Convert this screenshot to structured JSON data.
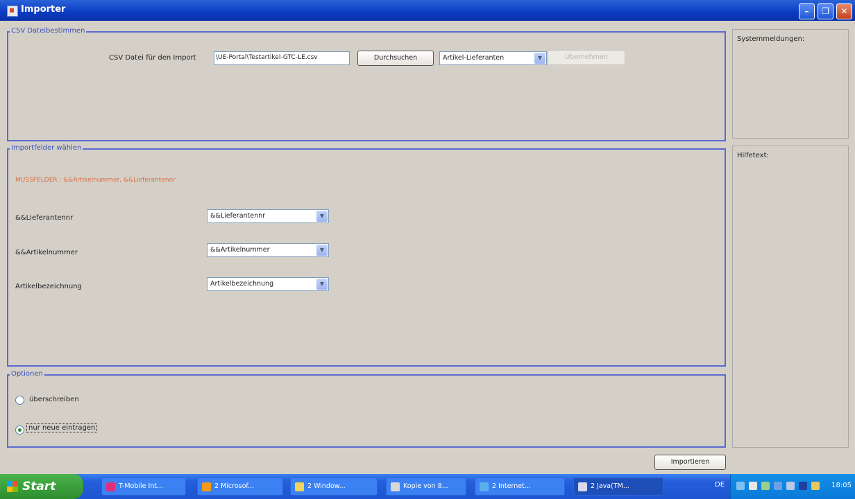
{
  "window": {
    "title": "Importer"
  },
  "csv": {
    "legend": "CSV Dateibestimmen",
    "label": "CSV Datei für den Import",
    "file_value": "\\UE-Portal\\Testartikel-GTC-LE.csv",
    "browse_label": "Durchsuchen",
    "type_selected": "Artikel-Lieferanten",
    "apply_label": "Übernehmen"
  },
  "side": {
    "messages_label": "Systemmeldungen:",
    "help_label": "Hilfetext:"
  },
  "fields": {
    "legend": "Importfelder wählen",
    "mandatory": "MUSSFELDER : &&Artikelnummer, &&Lieferantennr",
    "rows": [
      {
        "label": "&&Lieferantennr",
        "selected": "&&Lieferantennr"
      },
      {
        "label": "&&Artikelnummer",
        "selected": "&&Artikelnummer"
      },
      {
        "label": "Artikelbezeichnung",
        "selected": "Artikelbezeichnung"
      }
    ]
  },
  "options": {
    "legend": "Optionen",
    "overwrite_label": "überschreiben",
    "new_only_label": "nur neue eintragen",
    "selected": "nur neue eintragen"
  },
  "import_label": "Importieren",
  "taskbar": {
    "start_label": "Start",
    "items": [
      {
        "label": "T-Mobile Int...",
        "icon": "tmobile-icon",
        "color": "#e0307a"
      },
      {
        "label": "2 Microsof...",
        "icon": "office-icon",
        "color": "#f29a1c"
      },
      {
        "label": "2 Window...",
        "icon": "folder-icon",
        "color": "#f2d35c"
      },
      {
        "label": "Kopie von 8...",
        "icon": "document-icon",
        "color": "#d8d8d8"
      },
      {
        "label": "2 Internet...",
        "icon": "ie-icon",
        "color": "#58b1ea"
      },
      {
        "label": "2 Java(TM...",
        "icon": "java-icon",
        "color": "#d9d9ee"
      }
    ],
    "lang": "DE",
    "clock": "18:05"
  },
  "colors": {
    "accent_border": "#5b6ad0",
    "mandatory_text": "#e06a3c",
    "title_bar": "#0a3bc2"
  }
}
